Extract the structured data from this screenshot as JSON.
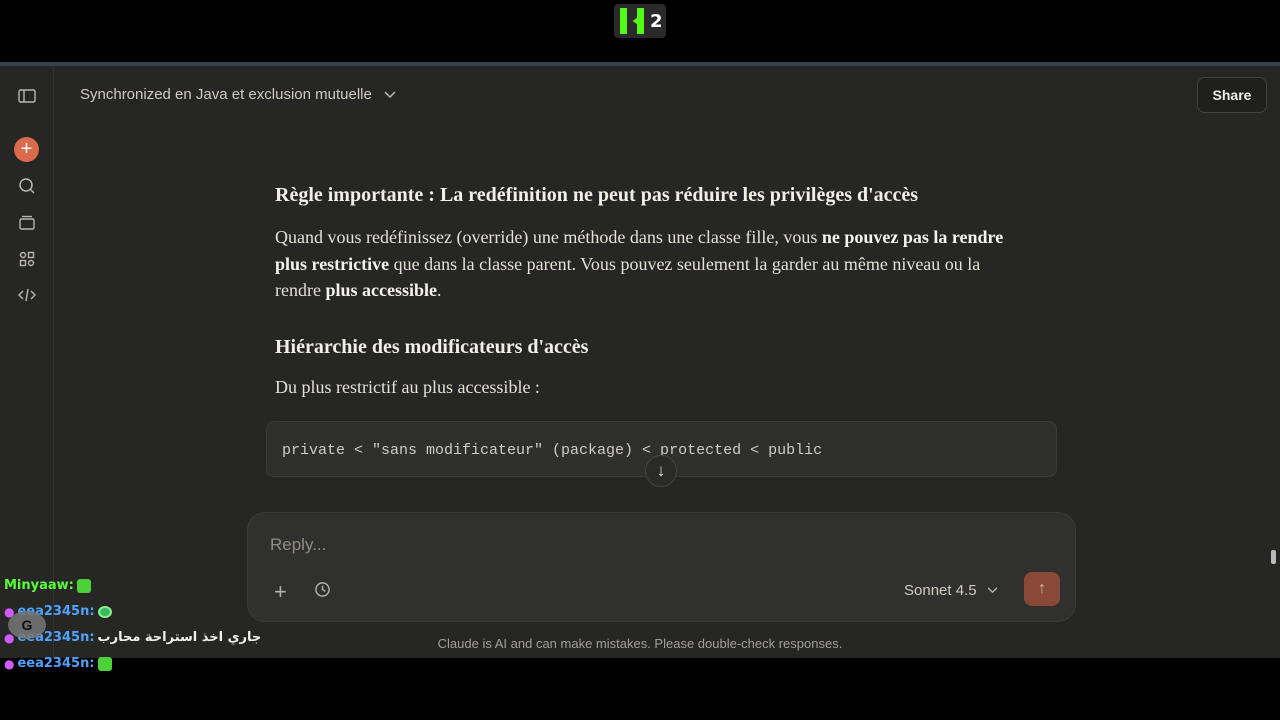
{
  "overlay": {
    "badge_count": "2",
    "chat": [
      {
        "user": "Minyaaw:",
        "message": "",
        "emote": "green-emote"
      },
      {
        "user": "eea2345n:",
        "message": "",
        "emote": "face-emote"
      },
      {
        "user": "eea2345n:",
        "message": "جاري اخذ استراحة محارب",
        "emote": ""
      },
      {
        "user": "eea2345n:",
        "message": "",
        "emote": "green-emote"
      }
    ],
    "avatar_letter": "G"
  },
  "header": {
    "title": "Synchronized en Java et exclusion mutuelle",
    "share_label": "Share"
  },
  "message": {
    "heading1": "Règle importante : La redéfinition ne peut pas réduire les privilèges d'accès",
    "para_a": "Quand vous redéfinissez (override) une méthode dans une classe fille, vous ",
    "para_b": "ne pouvez pas la rendre plus restrictive",
    "para_c": " que dans la classe parent. Vous pouvez seulement la garder au même niveau ou la rendre ",
    "para_d": "plus accessible",
    "para_e": ".",
    "heading2": "Hiérarchie des modificateurs d'accès",
    "order_text": "Du plus restrictif au plus accessible :",
    "code": "private < \"sans modificateur\" (package) < protected < public"
  },
  "composer": {
    "placeholder": "Reply...",
    "model": "Sonnet 4.5"
  },
  "footer": {
    "disclaimer": "Claude is AI and can make mistakes. Please double-check responses."
  },
  "colors": {
    "accent": "#d96a4a",
    "kick_green": "#53fc18"
  }
}
